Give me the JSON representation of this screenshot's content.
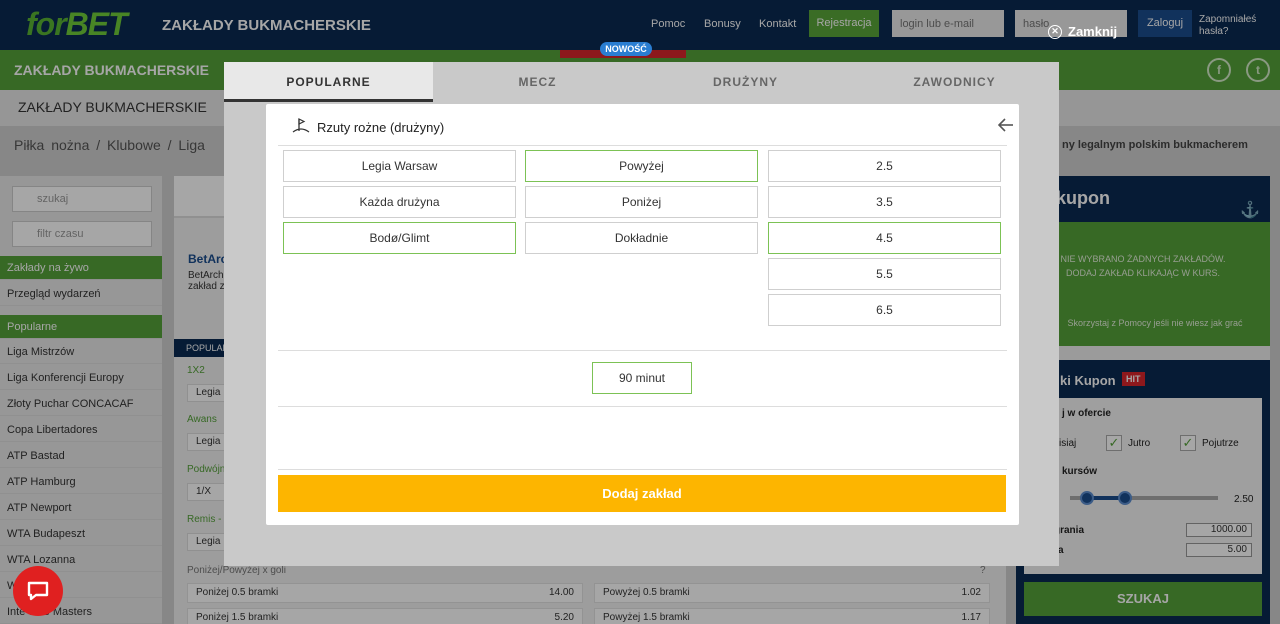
{
  "header": {
    "logo_prefix": "for",
    "logo_suffix": "BET",
    "site_title": "ZAKŁADY BUKMACHERSKIE",
    "links": [
      "Pomoc",
      "Bonusy",
      "Kontakt"
    ],
    "register_label": "Rejestracja",
    "login_placeholder": "login lub e-mail",
    "password_placeholder": "hasło",
    "login_button": "Zaloguj",
    "forgot": "Zapomniałeś hasła?",
    "close_label": "Zamknij"
  },
  "nav": {
    "green_title": "ZAKŁADY BUKMACHERSKIE",
    "new_badge": "NOWOŚĆ",
    "section_title": "ZAKŁADY BUKMACHERSKIE",
    "breadcrumb": "Piłka nożna / Klubowe / Liga",
    "legal_text": "ny legalnym polskim bukmacherem"
  },
  "sidebar": {
    "search_placeholder": "szukaj",
    "time_filter": "filtr czasu",
    "items": [
      {
        "label": "Zakłady na żywo",
        "highlight": true
      },
      {
        "label": "Przegląd wydarzeń",
        "highlight": false
      },
      {
        "label": "Popularne",
        "highlight": true
      },
      {
        "label": "Liga Mistrzów",
        "highlight": false
      },
      {
        "label": "Liga Konferencji Europy",
        "highlight": false
      },
      {
        "label": "Złoty Puchar CONCACAF",
        "highlight": false
      },
      {
        "label": "Copa Libertadores",
        "highlight": false
      },
      {
        "label": "ATP Bastad",
        "highlight": false
      },
      {
        "label": "ATP Hamburg",
        "highlight": false
      },
      {
        "label": "ATP Newport",
        "highlight": false
      },
      {
        "label": "WTA Budapeszt",
        "highlight": false
      },
      {
        "label": "WTA Lozanna",
        "highlight": false
      },
      {
        "label": "W",
        "highlight": false
      },
      {
        "label": "Inte        eme Masters",
        "highlight": false
      }
    ]
  },
  "main": {
    "betarch_title": "BetArch",
    "betarch_text": "BetArch zakład z",
    "popular_tab": "POPULAR",
    "market_1x2": "1X2",
    "market_awans": "Awans",
    "market_podwojna": "Podwójn",
    "market_remis": "Remis -",
    "box_legia": "Legia",
    "box_1x": "1/X",
    "ou_label": "Poniżej/Powyżej x goli",
    "ou_question": "?",
    "odds_rows": [
      {
        "left_label": "Poniżej 0.5 bramki",
        "left_odd": "14.00",
        "right_label": "Powyżej 0.5 bramki",
        "right_odd": "1.02"
      },
      {
        "left_label": "Poniżej 1.5 bramki",
        "left_odd": "5.20",
        "right_label": "Powyżej 1.5 bramki",
        "right_odd": "1.17"
      }
    ]
  },
  "coupon": {
    "title": "kupon",
    "msg_1": "NIE WYBRANO ŻADNYCH ZAKŁADÓW.",
    "msg_2": "DODAJ ZAKŁAD KLIKAJĄC W KURS.",
    "help": "Skorzystaj z Pomocy jeśli nie wiesz jak grać",
    "quick_title": "ki Kupon",
    "hit": "HIT",
    "in_offer": "j w ofercie",
    "today": "zisiaj",
    "tomorrow": "Jutro",
    "day_after": "Pojutrze",
    "odds_range": "kursów",
    "odds_max": "2.50",
    "win_label": "grania",
    "win_value": "1000.00",
    "stake_label": "a",
    "stake_value": "5.00",
    "search": "SZUKAJ"
  },
  "modal": {
    "tabs": [
      {
        "label": "POPULARNE",
        "active": true
      },
      {
        "label": "MECZ",
        "active": false
      },
      {
        "label": "DRUŻYNY",
        "active": false
      },
      {
        "label": "ZAWODNICY",
        "active": false
      }
    ],
    "title": "Rzuty rożne (drużyny)",
    "team_options": [
      {
        "label": "Legia Warsaw",
        "selected": false
      },
      {
        "label": "Każda drużyna",
        "selected": false
      },
      {
        "label": "Bodø/Glimt",
        "selected": true
      }
    ],
    "type_options": [
      {
        "label": "Powyżej",
        "selected": true
      },
      {
        "label": "Poniżej",
        "selected": false
      },
      {
        "label": "Dokładnie",
        "selected": false
      }
    ],
    "line_options": [
      {
        "label": "2.5",
        "selected": false
      },
      {
        "label": "3.5",
        "selected": false
      },
      {
        "label": "4.5",
        "selected": true
      },
      {
        "label": "5.5",
        "selected": false
      },
      {
        "label": "6.5",
        "selected": false
      }
    ],
    "period": "90 minut",
    "add_button": "Dodaj zakład"
  },
  "colors": {
    "navy": "#0a2a52",
    "green": "#55a13a",
    "yellow": "#fdb500",
    "selected_border": "#7cc255"
  }
}
